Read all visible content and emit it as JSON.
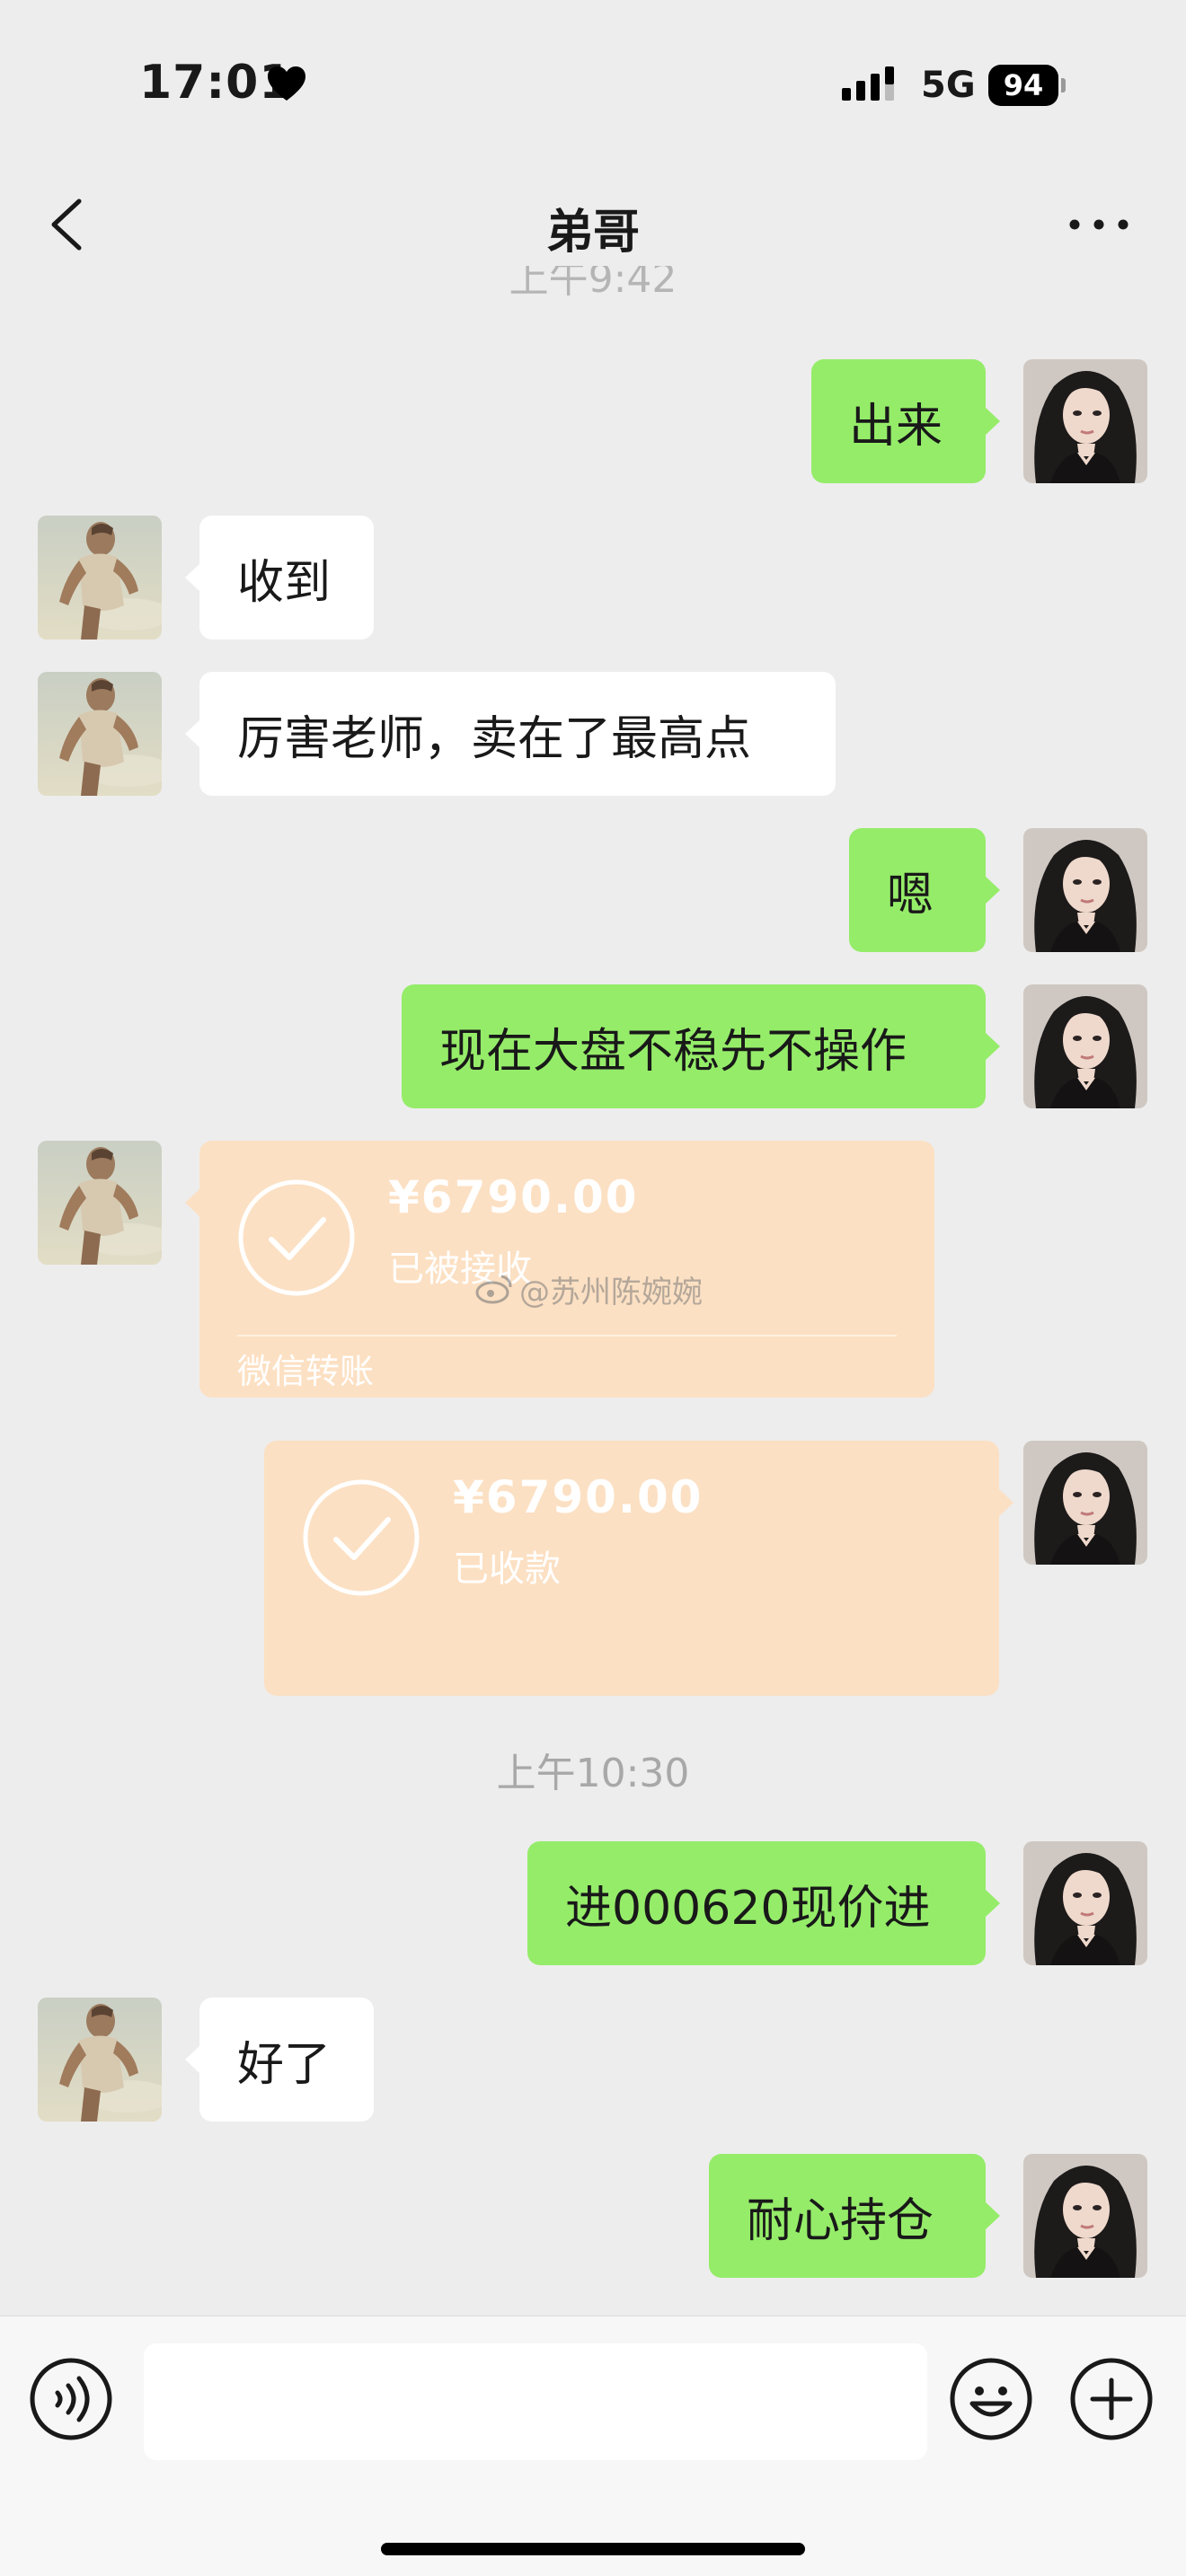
{
  "status_bar": {
    "time": "17:01",
    "network": "5G",
    "battery": "94",
    "icons": [
      "heart-icon",
      "signal-icon",
      "battery-icon"
    ]
  },
  "nav": {
    "title": "弟哥",
    "back_icon": "chevron-left-icon",
    "more_icon": "more-dots-icon"
  },
  "partial_timestamp": "上午9:42",
  "messages": [
    {
      "side": "right",
      "text": "出来"
    },
    {
      "side": "left",
      "text": "收到"
    },
    {
      "side": "left",
      "text": "厉害老师，卖在了最高点"
    },
    {
      "side": "right",
      "text": "嗯"
    },
    {
      "side": "right",
      "text": "现在大盘不稳先不操作"
    }
  ],
  "transfer_in": {
    "amount": "¥6790.00",
    "status": "已被接收",
    "footer": "微信转账"
  },
  "transfer_out": {
    "amount": "¥6790.00",
    "status": "已收款"
  },
  "watermark": "@苏州陈婉婉",
  "timestamp2": "上午10:30",
  "messages2": [
    {
      "side": "right",
      "text": "进000620现价进"
    },
    {
      "side": "left",
      "text": "好了"
    },
    {
      "side": "right",
      "text": "耐心持仓"
    }
  ],
  "input_bar": {
    "placeholder": "",
    "icons": [
      "voice-icon",
      "emoji-icon",
      "plus-icon"
    ]
  },
  "colors": {
    "background": "#ededed",
    "sent_bubble": "#95ec69",
    "received_bubble": "#ffffff",
    "transfer_card": "#fce0c3"
  }
}
